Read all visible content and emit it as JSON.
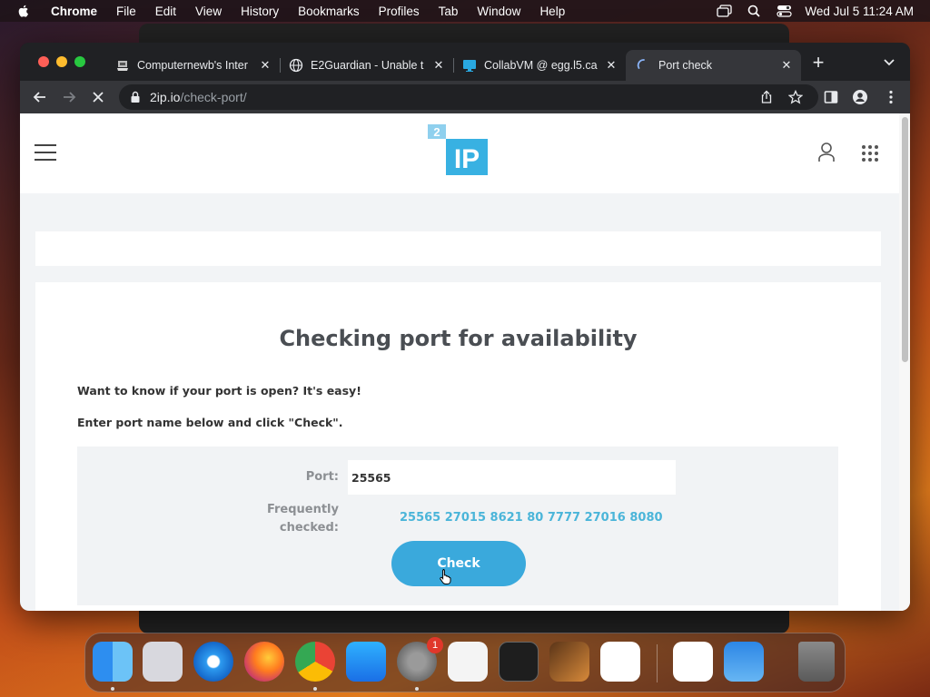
{
  "menubar": {
    "app_name": "Chrome",
    "items": [
      "File",
      "Edit",
      "View",
      "History",
      "Bookmarks",
      "Profiles",
      "Tab",
      "Window",
      "Help"
    ],
    "clock": "Wed Jul 5  11:24 AM"
  },
  "tabs": [
    {
      "title": "Computernewb's Inter",
      "icon": "computernewb-icon",
      "active": false
    },
    {
      "title": "E2Guardian - Unable t",
      "icon": "globe-icon",
      "active": false
    },
    {
      "title": "CollabVM @ egg.l5.ca",
      "icon": "monitor-icon",
      "active": false
    },
    {
      "title": "Port check",
      "icon": "loading-spinner-icon",
      "active": true
    }
  ],
  "address_bar": {
    "domain": "2ip.io",
    "path": "/check-port/"
  },
  "page": {
    "logo_small": "2",
    "logo_big": "IP",
    "heading": "Checking port for availability",
    "intro_1": "Want to know if your port is open? It's easy!",
    "intro_2": "Enter port name below and click \"Check\".",
    "port_label": "Port:",
    "port_value": "25565",
    "frequent_label": "Frequently checked:",
    "frequent_ports": [
      "25565",
      "27015",
      "8621",
      "80",
      "7777",
      "27016",
      "8080"
    ],
    "check_label": "Check"
  },
  "dock": {
    "apps": [
      "finder",
      "launchpad",
      "safari",
      "firefox",
      "chrome",
      "app-store",
      "system-settings",
      "textedit",
      "terminal",
      "garageband",
      "vscode",
      "visual-studio",
      "weather",
      "trash"
    ],
    "system_settings_badge": "1"
  },
  "colors": {
    "accent": "#3aa9dc",
    "link": "#4bb5d9",
    "heading": "#4a4e53"
  }
}
